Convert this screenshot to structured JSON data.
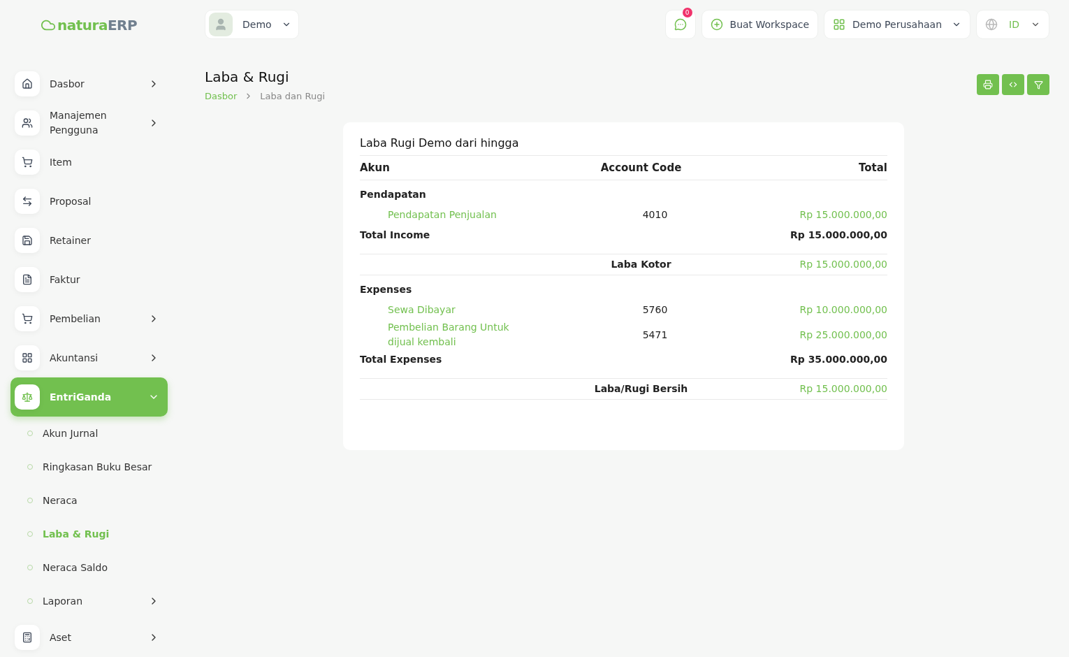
{
  "logo": {
    "brand": "natura",
    "suffix": "ERP"
  },
  "user_menu": {
    "name": "Demo"
  },
  "header": {
    "notification_count": "0",
    "create_workspace": "Buat Workspace",
    "company": "Demo Perusahaan",
    "language": "ID"
  },
  "sidebar": {
    "items": [
      {
        "label": "Dasbor",
        "kind": "group",
        "expanded": false,
        "selected": false
      },
      {
        "label": "Manajemen Pengguna",
        "kind": "group",
        "expanded": false,
        "selected": false
      },
      {
        "label": "Item",
        "kind": "link",
        "selected": false
      },
      {
        "label": "Proposal",
        "kind": "link",
        "selected": false
      },
      {
        "label": "Retainer",
        "kind": "link",
        "selected": false
      },
      {
        "label": "Faktur",
        "kind": "link",
        "selected": false
      },
      {
        "label": "Pembelian",
        "kind": "group",
        "expanded": false,
        "selected": false
      },
      {
        "label": "Akuntansi",
        "kind": "group",
        "expanded": false,
        "selected": false
      },
      {
        "label": "EntriGanda",
        "kind": "group",
        "expanded": true,
        "selected": true,
        "children": [
          {
            "label": "Akun Jurnal",
            "kind": "link",
            "selected": false
          },
          {
            "label": "Ringkasan Buku Besar",
            "kind": "link",
            "selected": false
          },
          {
            "label": "Neraca",
            "kind": "link",
            "selected": false
          },
          {
            "label": "Laba & Rugi",
            "kind": "link",
            "selected": true
          },
          {
            "label": "Neraca Saldo",
            "kind": "link",
            "selected": false
          },
          {
            "label": "Laporan",
            "kind": "group",
            "expanded": false,
            "selected": false
          }
        ]
      },
      {
        "label": "Aset",
        "kind": "group",
        "expanded": false,
        "selected": false
      }
    ]
  },
  "page": {
    "title": "Laba & Rugi",
    "breadcrumb": [
      {
        "label": "Dasbor",
        "kind": "link"
      },
      {
        "label": "Laba dan Rugi",
        "kind": "current"
      }
    ]
  },
  "report": {
    "title": "Laba Rugi Demo dari hingga",
    "columns": [
      "Akun",
      "Account Code",
      "Total"
    ],
    "rows": [
      {
        "kind": "section",
        "label": "Pendapatan"
      },
      {
        "kind": "account",
        "label": "Pendapatan Penjualan",
        "code": "4010",
        "total": "Rp 15.000.000,00"
      },
      {
        "kind": "total",
        "label": "Total Income",
        "total": "Rp 15.000.000,00"
      },
      {
        "kind": "summary",
        "label": "Laba Kotor",
        "total": "Rp 15.000.000,00"
      },
      {
        "kind": "section",
        "label": "Expenses"
      },
      {
        "kind": "account",
        "label": "Sewa Dibayar",
        "code": "5760",
        "total": "Rp 10.000.000,00"
      },
      {
        "kind": "account",
        "label": "Pembelian Barang Untuk dijual kembali",
        "code": "5471",
        "total": "Rp 25.000.000,00"
      },
      {
        "kind": "total",
        "label": "Total Expenses",
        "total": "Rp 35.000.000,00"
      },
      {
        "kind": "summary",
        "label": "Laba/Rugi Bersih",
        "total": "Rp 15.000.000,00"
      }
    ]
  }
}
